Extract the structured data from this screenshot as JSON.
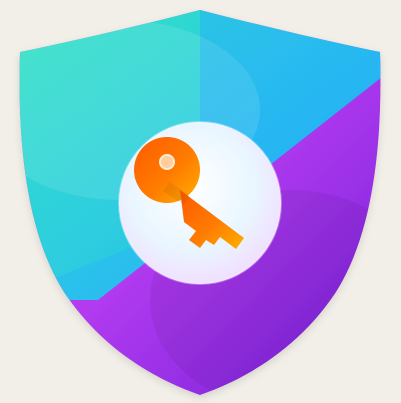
{
  "icon": {
    "name": "shield-key-icon",
    "background_color": "#f2efe8",
    "shield_colors": {
      "teal": "#31e0c2",
      "sky_blue": "#23a9ff",
      "magenta": "#d94cf0",
      "purple": "#7e1fd6"
    },
    "circle_colors": {
      "light_blue": "#d8f2ff",
      "light_pink": "#f6d4ff",
      "white": "#fbfbff"
    },
    "key_colors": {
      "orange": "#ff6a00",
      "amber": "#ffb000"
    }
  }
}
